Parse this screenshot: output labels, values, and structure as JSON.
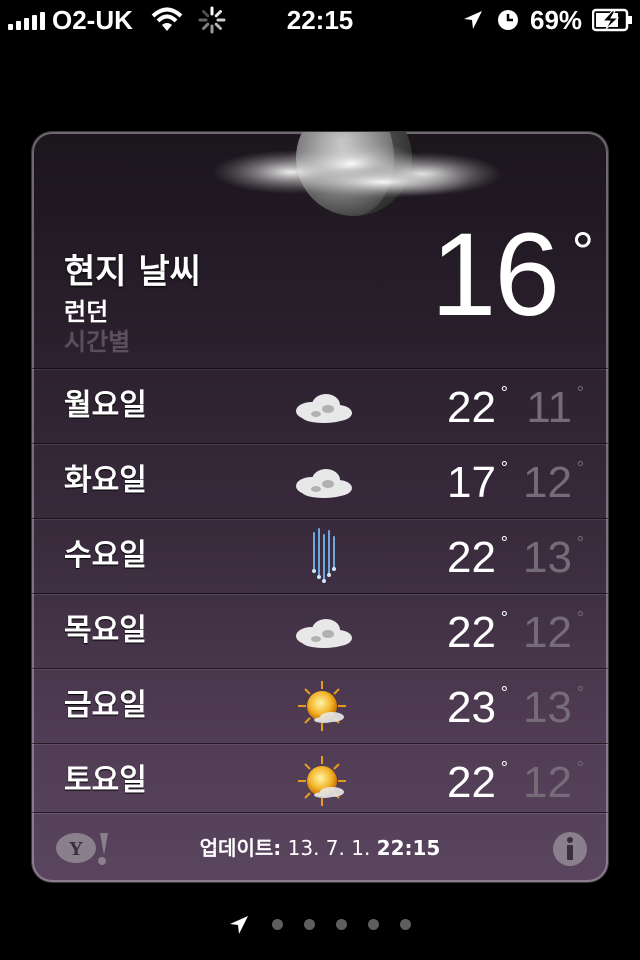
{
  "status_bar": {
    "carrier": "O2-UK",
    "time": "22:15",
    "battery_percent": "69%",
    "icons": [
      "signal-bars-icon",
      "wifi-icon",
      "activity-spinner-icon",
      "location-arrow-icon",
      "alarm-clock-icon",
      "battery-charging-icon"
    ]
  },
  "header": {
    "title": "현지 날씨",
    "city": "런던",
    "hourly_link": "시간별",
    "current_temp": "16",
    "degree_symbol": "°",
    "condition_icon": "moon-cloud-icon"
  },
  "forecast": [
    {
      "day": "월요일",
      "icon": "cloudy-icon",
      "high": "22",
      "low": "11"
    },
    {
      "day": "화요일",
      "icon": "cloudy-icon",
      "high": "17",
      "low": "12"
    },
    {
      "day": "수요일",
      "icon": "rain-icon",
      "high": "22",
      "low": "13"
    },
    {
      "day": "목요일",
      "icon": "cloudy-icon",
      "high": "22",
      "low": "12"
    },
    {
      "day": "금요일",
      "icon": "sun-cloud-icon",
      "high": "23",
      "low": "13"
    },
    {
      "day": "토요일",
      "icon": "sun-cloud-icon",
      "high": "22",
      "low": "12"
    }
  ],
  "footer": {
    "provider_logo": "yahoo-logo",
    "updated_label": "업데이트:",
    "updated_date": "13. 7. 1.",
    "updated_time": "22:15",
    "info_icon": "info-icon"
  },
  "pager": {
    "pages": 6,
    "current_page": 1,
    "first_page_icon": "location-arrow-icon"
  },
  "colors": {
    "card_top": "#1b151c",
    "card_bottom": "#5a455e",
    "low_temp_text": "#766b79",
    "hourly_link_text": "#5b4f5d"
  }
}
